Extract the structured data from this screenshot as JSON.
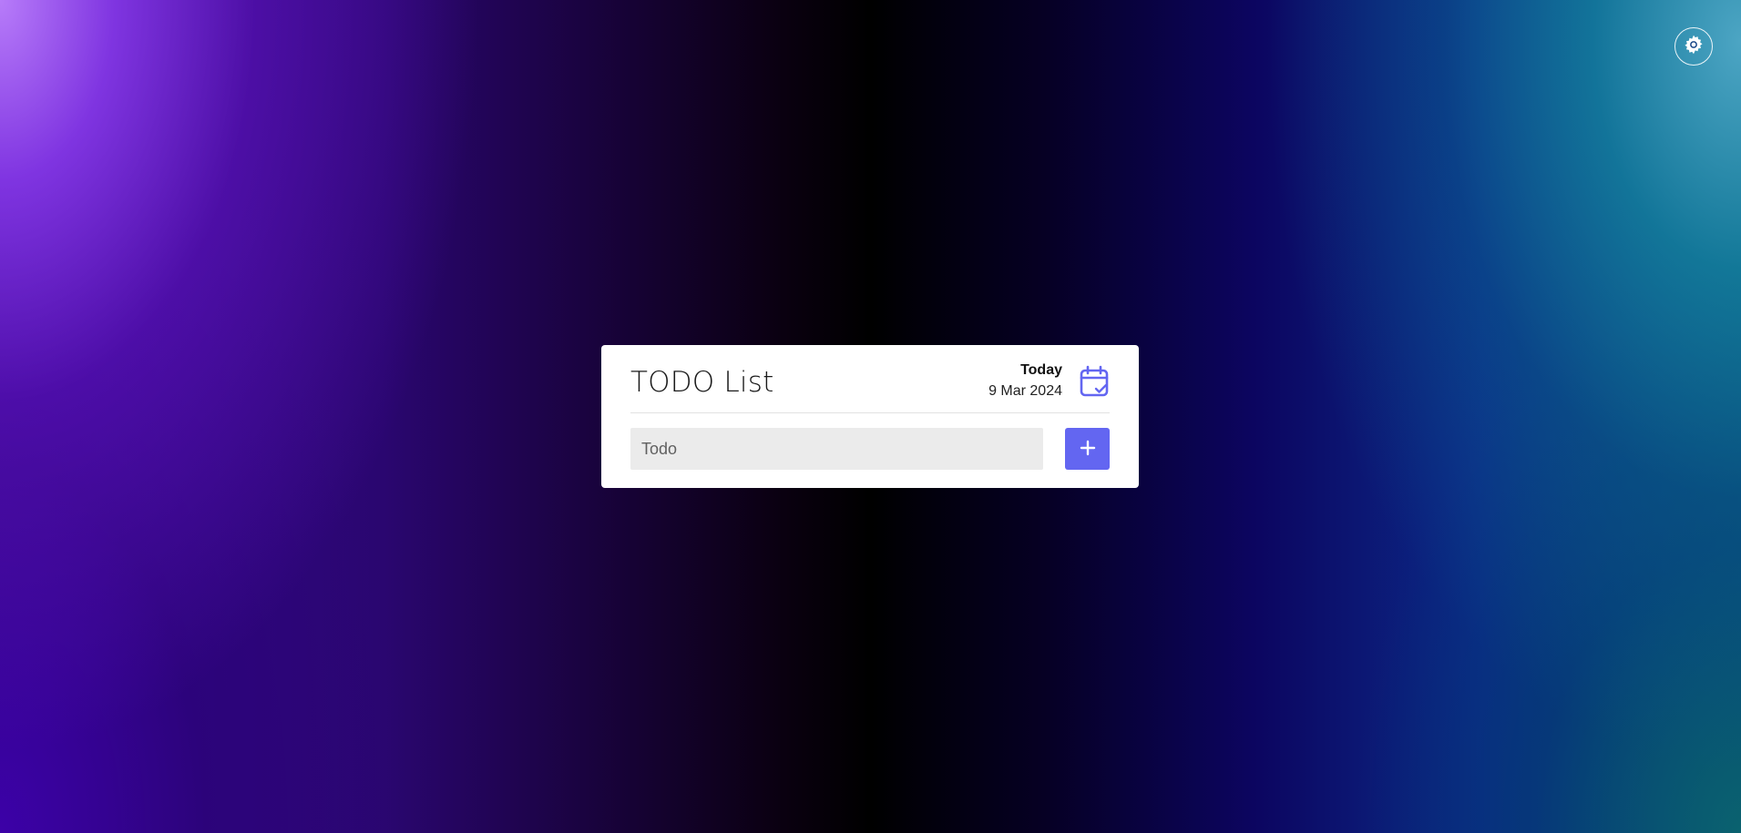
{
  "header": {
    "settings_icon": "gear-icon"
  },
  "card": {
    "title": "TODO List",
    "today_label": "Today",
    "date": "9 Mar 2024",
    "calendar_icon": "calendar-check-icon"
  },
  "form": {
    "input_placeholder": "Todo",
    "input_value": "",
    "add_icon": "plus-icon"
  },
  "colors": {
    "accent": "#6366f1",
    "card_bg": "#ffffff",
    "input_bg": "#ebebeb"
  }
}
